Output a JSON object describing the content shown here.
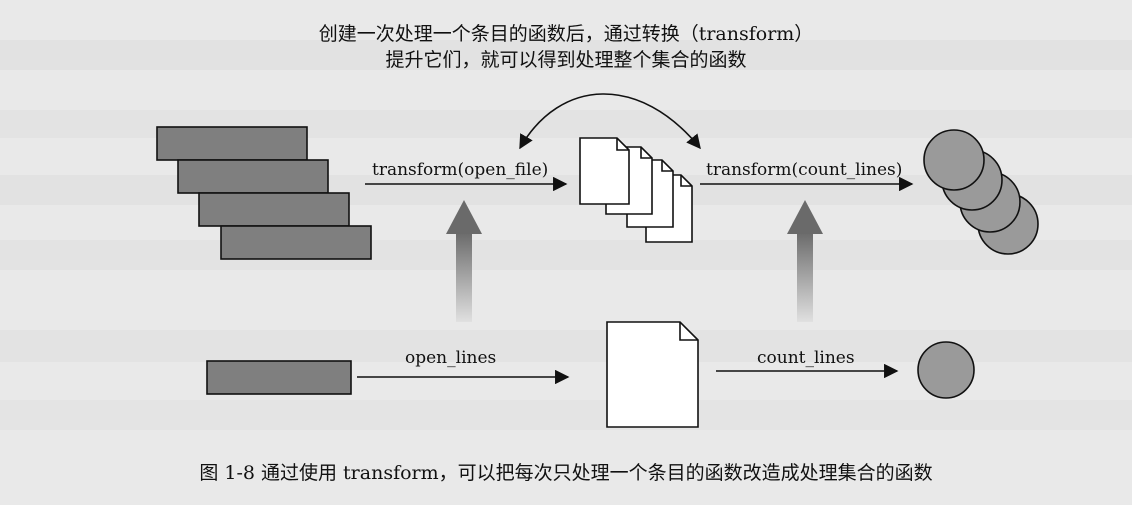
{
  "annotation": {
    "line1": "创建一次处理一个条目的函数后，通过转换（transform）",
    "line2": "提升它们，就可以得到处理整个集合的函数"
  },
  "labels": {
    "transform_open_file": "transform(open_file)",
    "transform_count_lines": "transform(count_lines)",
    "open_lines": "open_lines",
    "count_lines": "count_lines"
  },
  "caption": "图 1-8    通过使用 transform，可以把每次只处理一个条目的函数改造成处理集合的函数",
  "colors": {
    "box_fill": "#7f7f7f",
    "circle_fill": "#9a9a9a",
    "stroke": "#111111",
    "doc_fill": "#ffffff",
    "background": "#e9e9e9"
  }
}
